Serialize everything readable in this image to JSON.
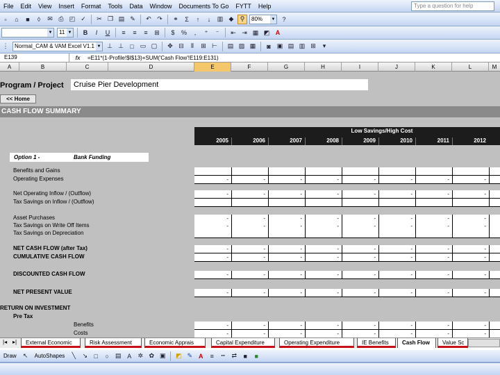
{
  "menubar": {
    "items": [
      "File",
      "Edit",
      "View",
      "Insert",
      "Format",
      "Tools",
      "Data",
      "Window",
      "Documents To Go",
      "FYTT ",
      "Help"
    ],
    "ask_placeholder": "Type a question for help"
  },
  "toolbar1": {
    "zoom": "80%"
  },
  "toolbar2": {
    "font": "",
    "size": "11"
  },
  "toolbar3": {
    "style": "Normal_CAM & VAM Excel V1.1"
  },
  "formula_bar": {
    "name_box": "E139",
    "fx": "fx",
    "formula": "=E11*(1-Profile!$I$13)+SUM('Cash Flow'!E119:E131)"
  },
  "columns": [
    "A",
    "B",
    "C",
    "D",
    "E",
    "F",
    "G",
    "H",
    "I",
    "J",
    "K",
    "L",
    "M"
  ],
  "sheet": {
    "program_label": "Program / Project",
    "program_value": "Cruise Pier Development",
    "home_button": "<< Home",
    "section_title": "CASH FLOW SUMMARY",
    "scenario": "Low Savings/High Cost",
    "years": [
      "2005",
      "2006",
      "2007",
      "2008",
      "2009",
      "2010",
      "2011",
      "2012"
    ],
    "option_label": "Option 1 -",
    "option_value": "Bank Funding",
    "rows": {
      "benefits": "Benefits and Gains",
      "operating": "Operating Expenses",
      "net_op": "Net Operating Inflow / (Outflow)",
      "tax_inflow": "Tax Savings on Inflow / (Outflow)",
      "asset": "Asset Purchases",
      "tax_writeoff": "Tax Savings on Write Off Items",
      "tax_dep": "Tax Savings on Depreciation",
      "net_cf": "NET CASH FLOW (after Tax)",
      "cum_cf": "CUMULATIVE CASH FLOW",
      "disc_cf": "DISCOUNTED CASH FLOW",
      "npv": "NET PRESENT VALUE",
      "roi": "RETURN ON INVESTMENT",
      "pretax": "Pre Tax",
      "roi_benefits": "Benefits",
      "roi_costs": "Costs"
    },
    "dash": "-"
  },
  "tabs": [
    "External Economic",
    "Risk Assessment",
    "Economic Apprais",
    "Capital Expenditure",
    "Operating Expenditure",
    "IE Benefits",
    "Cash Flow",
    "Value Sc"
  ],
  "drawbar": {
    "draw": "Draw",
    "autoshapes": "AutoShapes"
  }
}
